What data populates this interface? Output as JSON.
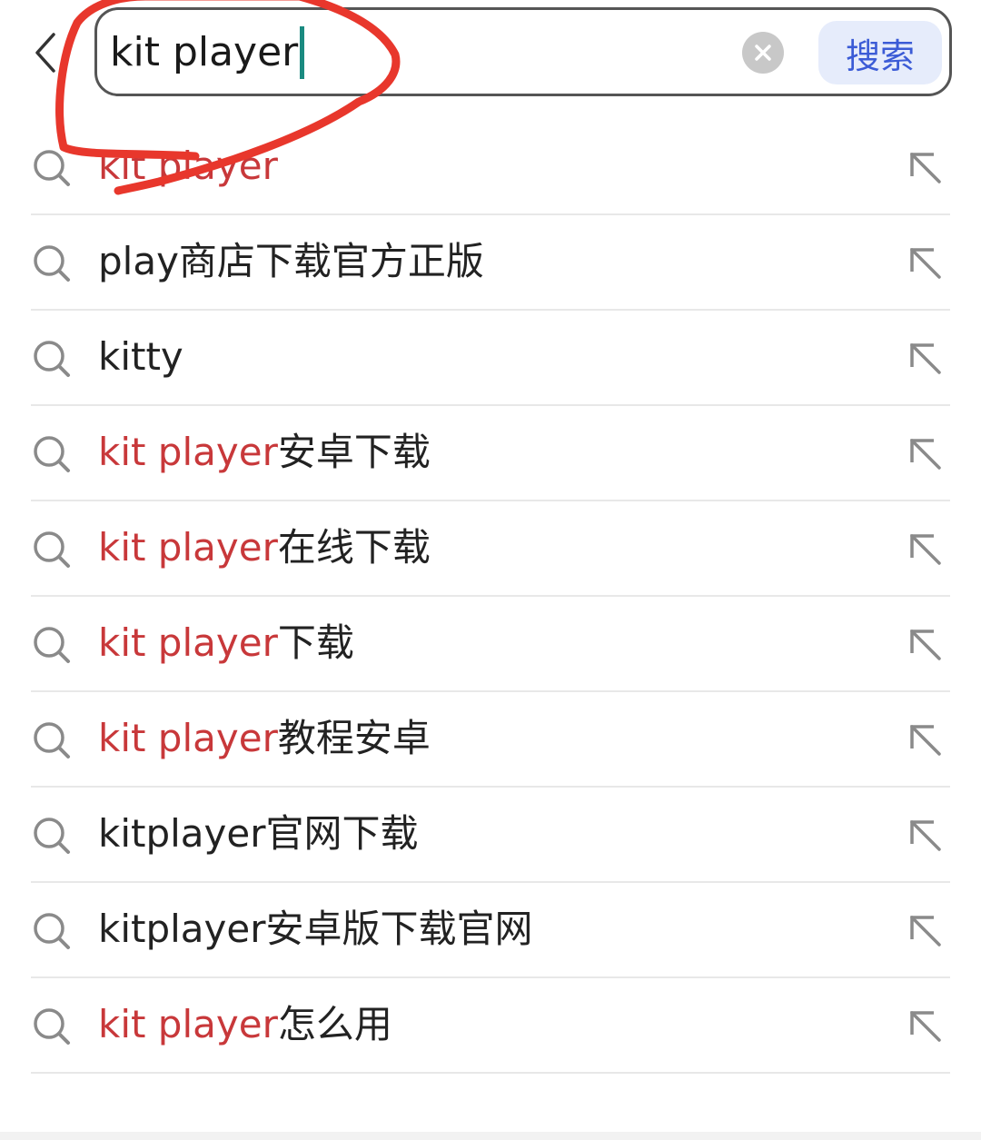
{
  "header": {
    "search_value": "kit player",
    "search_button_label": "搜索",
    "icons": {
      "back": "chevron-left-icon",
      "clear": "close-circle-icon"
    }
  },
  "suggestions": [
    {
      "highlight": "kit player",
      "rest": ""
    },
    {
      "highlight": "",
      "rest": "play商店下载官方正版"
    },
    {
      "highlight": "",
      "rest": "kitty"
    },
    {
      "highlight": "kit player",
      "rest": "安卓下载"
    },
    {
      "highlight": "kit player",
      "rest": "在线下载"
    },
    {
      "highlight": "kit player",
      "rest": "下载"
    },
    {
      "highlight": "kit player",
      "rest": "教程安卓"
    },
    {
      "highlight": "",
      "rest": "kitplayer官网下载"
    },
    {
      "highlight": "",
      "rest": "kitplayer安卓版下载官网"
    },
    {
      "highlight": "kit player",
      "rest": "怎么用"
    }
  ],
  "colors": {
    "highlight": "#c8383a",
    "text": "#222222",
    "search_button_bg": "#e6ecfb",
    "search_button_text": "#3b5bd6",
    "caret": "#1a8a80",
    "annotation": "#e8372c"
  }
}
